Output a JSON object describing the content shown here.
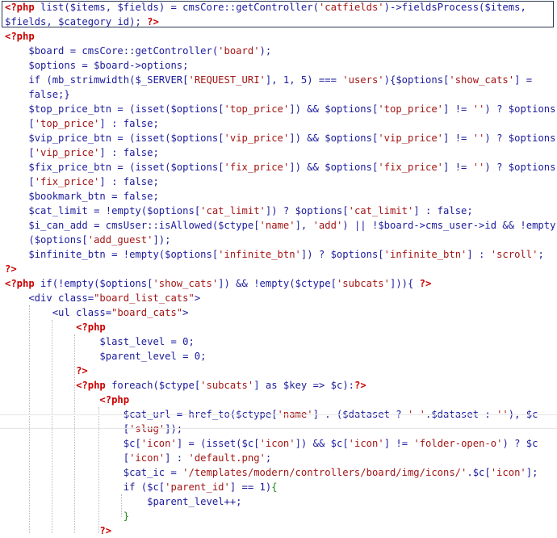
{
  "code_lines": [
    [
      [
        "tag",
        "<?php "
      ],
      [
        "op",
        "list("
      ],
      [
        "var",
        "$items"
      ],
      [
        "op",
        ", "
      ],
      [
        "var",
        "$fields"
      ],
      [
        "op",
        ") = cmsCore::getController("
      ],
      [
        "str",
        "'catfields'"
      ],
      [
        "op",
        ")->fieldsProcess("
      ],
      [
        "var",
        "$items"
      ],
      [
        "op",
        ","
      ]
    ],
    [
      [
        "var",
        "$fields"
      ],
      [
        "op",
        ", "
      ],
      [
        "var",
        "$category_id"
      ],
      [
        "op",
        "); "
      ],
      [
        "tag",
        "?>"
      ]
    ],
    [
      [
        "tag",
        "<?php"
      ]
    ],
    [
      [
        "op",
        "    "
      ],
      [
        "var",
        "$board"
      ],
      [
        "op",
        " = cmsCore::getController("
      ],
      [
        "str",
        "'board'"
      ],
      [
        "op",
        ");"
      ]
    ],
    [
      [
        "op",
        "    "
      ],
      [
        "var",
        "$options"
      ],
      [
        "op",
        " = "
      ],
      [
        "var",
        "$board"
      ],
      [
        "op",
        "->options;"
      ]
    ],
    [
      [
        "op",
        "    if (mb_strimwidth("
      ],
      [
        "var",
        "$_SERVER"
      ],
      [
        "op",
        "["
      ],
      [
        "str",
        "'REQUEST_URI'"
      ],
      [
        "op",
        "], 1, 5) === "
      ],
      [
        "str",
        "'users'"
      ],
      [
        "op",
        "){"
      ],
      [
        "var",
        "$options"
      ],
      [
        "op",
        "["
      ],
      [
        "str",
        "'show_cats'"
      ],
      [
        "op",
        "] ="
      ]
    ],
    [
      [
        "op",
        "    false;}"
      ]
    ],
    [
      [
        "op",
        "    "
      ],
      [
        "var",
        "$top_price_btn"
      ],
      [
        "op",
        " = (isset("
      ],
      [
        "var",
        "$options"
      ],
      [
        "op",
        "["
      ],
      [
        "str",
        "'top_price'"
      ],
      [
        "op",
        "]) && "
      ],
      [
        "var",
        "$options"
      ],
      [
        "op",
        "["
      ],
      [
        "str",
        "'top_price'"
      ],
      [
        "op",
        "] != "
      ],
      [
        "str",
        "''"
      ],
      [
        "op",
        ") ? "
      ],
      [
        "var",
        "$options"
      ]
    ],
    [
      [
        "op",
        "    ["
      ],
      [
        "str",
        "'top_price'"
      ],
      [
        "op",
        "] : false;"
      ]
    ],
    [
      [
        "op",
        "    "
      ],
      [
        "var",
        "$vip_price_btn"
      ],
      [
        "op",
        " = (isset("
      ],
      [
        "var",
        "$options"
      ],
      [
        "op",
        "["
      ],
      [
        "str",
        "'vip_price'"
      ],
      [
        "op",
        "]) && "
      ],
      [
        "var",
        "$options"
      ],
      [
        "op",
        "["
      ],
      [
        "str",
        "'vip_price'"
      ],
      [
        "op",
        "] != "
      ],
      [
        "str",
        "''"
      ],
      [
        "op",
        ") ? "
      ],
      [
        "var",
        "$options"
      ]
    ],
    [
      [
        "op",
        "    ["
      ],
      [
        "str",
        "'vip_price'"
      ],
      [
        "op",
        "] : false;"
      ]
    ],
    [
      [
        "op",
        "    "
      ],
      [
        "var",
        "$fix_price_btn"
      ],
      [
        "op",
        " = (isset("
      ],
      [
        "var",
        "$options"
      ],
      [
        "op",
        "["
      ],
      [
        "str",
        "'fix_price'"
      ],
      [
        "op",
        "]) && "
      ],
      [
        "var",
        "$options"
      ],
      [
        "op",
        "["
      ],
      [
        "str",
        "'fix_price'"
      ],
      [
        "op",
        "] != "
      ],
      [
        "str",
        "''"
      ],
      [
        "op",
        ") ? "
      ],
      [
        "var",
        "$options"
      ]
    ],
    [
      [
        "op",
        "    ["
      ],
      [
        "str",
        "'fix_price'"
      ],
      [
        "op",
        "] : false;"
      ]
    ],
    [
      [
        "op",
        "    "
      ],
      [
        "var",
        "$bookmark_btn"
      ],
      [
        "op",
        " = false;"
      ]
    ],
    [
      [
        "op",
        "    "
      ],
      [
        "var",
        "$cat_limit"
      ],
      [
        "op",
        " = !empty("
      ],
      [
        "var",
        "$options"
      ],
      [
        "op",
        "["
      ],
      [
        "str",
        "'cat_limit'"
      ],
      [
        "op",
        "]) ? "
      ],
      [
        "var",
        "$options"
      ],
      [
        "op",
        "["
      ],
      [
        "str",
        "'cat_limit'"
      ],
      [
        "op",
        "] : false;"
      ]
    ],
    [
      [
        "op",
        "    "
      ],
      [
        "var",
        "$i_can_add"
      ],
      [
        "op",
        " = cmsUser::isAllowed("
      ],
      [
        "var",
        "$ctype"
      ],
      [
        "op",
        "["
      ],
      [
        "str",
        "'name'"
      ],
      [
        "op",
        "], "
      ],
      [
        "str",
        "'add'"
      ],
      [
        "op",
        ") || !"
      ],
      [
        "var",
        "$board"
      ],
      [
        "op",
        "->cms_user->id && !empty"
      ]
    ],
    [
      [
        "op",
        "    ("
      ],
      [
        "var",
        "$options"
      ],
      [
        "op",
        "["
      ],
      [
        "str",
        "'add_guest'"
      ],
      [
        "op",
        "]);"
      ]
    ],
    [
      [
        "op",
        "    "
      ],
      [
        "var",
        "$infinite_btn"
      ],
      [
        "op",
        " = !empty("
      ],
      [
        "var",
        "$options"
      ],
      [
        "op",
        "["
      ],
      [
        "str",
        "'infinite_btn'"
      ],
      [
        "op",
        "]) ? "
      ],
      [
        "var",
        "$options"
      ],
      [
        "op",
        "["
      ],
      [
        "str",
        "'infinite_btn'"
      ],
      [
        "op",
        "] : "
      ],
      [
        "str",
        "'scroll'"
      ],
      [
        "op",
        ";"
      ]
    ],
    [
      [
        "tag",
        "?>"
      ]
    ],
    [
      [
        "tag",
        "<?php "
      ],
      [
        "op",
        "if(!empty("
      ],
      [
        "var",
        "$options"
      ],
      [
        "op",
        "["
      ],
      [
        "str",
        "'show_cats'"
      ],
      [
        "op",
        "]) && !empty("
      ],
      [
        "var",
        "$ctype"
      ],
      [
        "op",
        "["
      ],
      [
        "str",
        "'subcats'"
      ],
      [
        "op",
        "])){ "
      ],
      [
        "tag",
        "?>"
      ]
    ],
    [
      [
        "op",
        "    <div class="
      ],
      [
        "str",
        "\"board_list_cats\""
      ],
      [
        "op",
        ">"
      ]
    ],
    [
      [
        "op",
        "        <ul class="
      ],
      [
        "str",
        "\"board_cats\""
      ],
      [
        "op",
        ">"
      ]
    ],
    [
      [
        "op",
        "            "
      ],
      [
        "tag",
        "<?php"
      ]
    ],
    [
      [
        "op",
        "                "
      ],
      [
        "var",
        "$last_level"
      ],
      [
        "op",
        " = 0;"
      ]
    ],
    [
      [
        "op",
        "                "
      ],
      [
        "var",
        "$parent_level"
      ],
      [
        "op",
        " = 0;"
      ]
    ],
    [
      [
        "op",
        "            "
      ],
      [
        "tag",
        "?>"
      ]
    ],
    [
      [
        "op",
        "            "
      ],
      [
        "tag",
        "<?php "
      ],
      [
        "op",
        "foreach("
      ],
      [
        "var",
        "$ctype"
      ],
      [
        "op",
        "["
      ],
      [
        "str",
        "'subcats'"
      ],
      [
        "op",
        "] as "
      ],
      [
        "var",
        "$key"
      ],
      [
        "op",
        " => "
      ],
      [
        "var",
        "$c"
      ],
      [
        "op",
        "):"
      ],
      [
        "tag",
        "?>"
      ]
    ],
    [
      [
        "op",
        "                "
      ],
      [
        "tag",
        "<?php"
      ]
    ],
    [
      [
        "op",
        "                    "
      ],
      [
        "var",
        "$cat_url"
      ],
      [
        "op",
        " = href_to("
      ],
      [
        "var",
        "$ctype"
      ],
      [
        "op",
        "["
      ],
      [
        "str",
        "'name'"
      ],
      [
        "op",
        "] . ("
      ],
      [
        "var",
        "$dataset"
      ],
      [
        "op",
        " ? "
      ],
      [
        "str",
        "'-'"
      ],
      [
        "op",
        "."
      ],
      [
        "var",
        "$dataset"
      ],
      [
        "op",
        " : "
      ],
      [
        "str",
        "''"
      ],
      [
        "op",
        "), "
      ],
      [
        "var",
        "$c"
      ]
    ],
    [
      [
        "op",
        "                    ["
      ],
      [
        "str",
        "'slug'"
      ],
      [
        "op",
        "]);"
      ]
    ],
    [
      [
        "op",
        "                    "
      ],
      [
        "var",
        "$c"
      ],
      [
        "op",
        "["
      ],
      [
        "str",
        "'icon'"
      ],
      [
        "op",
        "] = (isset("
      ],
      [
        "var",
        "$c"
      ],
      [
        "op",
        "["
      ],
      [
        "str",
        "'icon'"
      ],
      [
        "op",
        "]) && "
      ],
      [
        "var",
        "$c"
      ],
      [
        "op",
        "["
      ],
      [
        "str",
        "'icon'"
      ],
      [
        "op",
        "] != "
      ],
      [
        "str",
        "'folder-open-o'"
      ],
      [
        "op",
        ") ? "
      ],
      [
        "var",
        "$c"
      ]
    ],
    [
      [
        "op",
        "                    ["
      ],
      [
        "str",
        "'icon'"
      ],
      [
        "op",
        "] : "
      ],
      [
        "str",
        "'default.png'"
      ],
      [
        "op",
        ";"
      ]
    ],
    [
      [
        "op",
        "                    "
      ],
      [
        "var",
        "$cat_ic"
      ],
      [
        "op",
        " = "
      ],
      [
        "str",
        "'/templates/modern/controllers/board/img/icons/'"
      ],
      [
        "op",
        "."
      ],
      [
        "var",
        "$c"
      ],
      [
        "op",
        "["
      ],
      [
        "str",
        "'icon'"
      ],
      [
        "op",
        "];"
      ]
    ],
    [
      [
        "op",
        "                    if ("
      ],
      [
        "var",
        "$c"
      ],
      [
        "op",
        "["
      ],
      [
        "str",
        "'parent_id'"
      ],
      [
        "op",
        "] == 1)"
      ],
      [
        "brace",
        "{"
      ]
    ],
    [
      [
        "op",
        "                        "
      ],
      [
        "var",
        "$parent_level"
      ],
      [
        "op",
        "++;"
      ]
    ],
    [
      [
        "op",
        "                    "
      ],
      [
        "brace",
        "}"
      ]
    ],
    [
      [
        "op",
        "                "
      ],
      [
        "tag",
        "?>"
      ]
    ]
  ]
}
